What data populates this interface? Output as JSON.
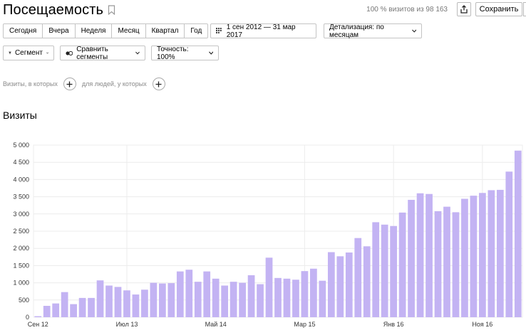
{
  "header": {
    "title": "Посещаемость",
    "visits_info": "100 % визитов из 98 163",
    "save_label": "Сохранить"
  },
  "periods": [
    "Сегодня",
    "Вчера",
    "Неделя",
    "Месяц",
    "Квартал",
    "Год"
  ],
  "date_range": "1 сен 2012 — 31 мар 2017",
  "detail_label": "Детализация: по месяцам",
  "segment_label": "Сегмент",
  "compare_label": "Сравнить сегменты",
  "accuracy_label": "Точность: 100%",
  "filters": {
    "visits_where": "Визиты, в которых",
    "people_where": "для людей, у которых"
  },
  "section_title": "Визиты",
  "colors": {
    "bar": "#c3b3f3",
    "grid": "#ececec"
  },
  "chart_data": {
    "type": "bar",
    "ylim": [
      0,
      5000
    ],
    "yticks": [
      0,
      500,
      1000,
      1500,
      2000,
      2500,
      3000,
      3500,
      4000,
      4500,
      5000
    ],
    "ytick_labels": [
      "0",
      "500",
      "1 000",
      "1 500",
      "2 000",
      "2 500",
      "3 000",
      "3 500",
      "4 000",
      "4 500",
      "5 000"
    ],
    "xtick_labels": [
      {
        "label": "Сен 12",
        "index": 0
      },
      {
        "label": "Июл 13",
        "index": 10
      },
      {
        "label": "Май 14",
        "index": 20
      },
      {
        "label": "Мар 15",
        "index": 30
      },
      {
        "label": "Янв 16",
        "index": 40
      },
      {
        "label": "Ноя 16",
        "index": 50
      }
    ],
    "vgrid_indices": [
      10,
      30,
      40,
      50
    ],
    "series": [
      {
        "values": [
          30,
          330,
          400,
          730,
          380,
          560,
          560,
          1070,
          920,
          880,
          780,
          660,
          800,
          1000,
          980,
          990,
          1330,
          1380,
          1030,
          1330,
          1120,
          920,
          1030,
          1000,
          1220,
          960,
          1730,
          1140,
          1120,
          1090,
          1340,
          1410,
          1060,
          1890,
          1770,
          1880,
          2300,
          2060,
          2760,
          2690,
          2650,
          3040,
          3410,
          3600,
          3580,
          3080,
          3210,
          3050,
          3440,
          3530,
          3610,
          3690,
          3700,
          4230,
          4840
        ]
      }
    ]
  }
}
